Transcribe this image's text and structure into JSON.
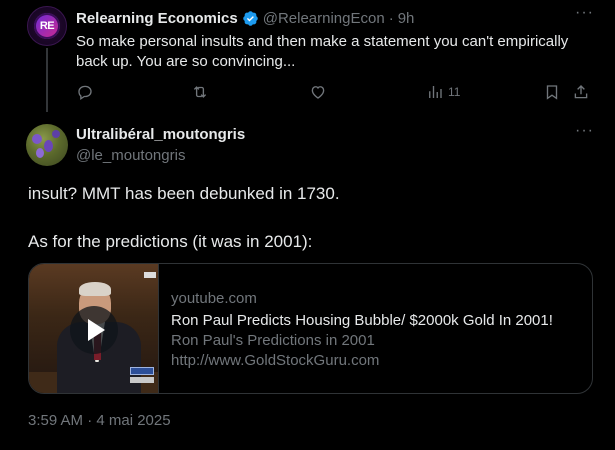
{
  "parent_tweet": {
    "avatar_text": "RE",
    "name": "Relearning Economics",
    "handle": "@RelearningEcon",
    "dot": "·",
    "time": "9h",
    "text": "So make personal insults and then make a statement you can't empirically back up. You are so convincing...",
    "actions": {
      "views_count": "11"
    }
  },
  "main_tweet": {
    "name": "Ultralibéral_moutongris",
    "handle": "@le_moutongris",
    "text_line1": "insult? MMT has been debunked in 1730.",
    "text_line2": "As for the predictions (it was in 2001):",
    "card": {
      "domain": "youtube.com",
      "title": "Ron Paul Predicts Housing Bubble/ $2000k Gold In 2001!",
      "description": "Ron Paul's Predictions in 2001",
      "url": "http://www.GoldStockGuru.com"
    },
    "timestamp": "3:59 AM · 4 mai 2025"
  },
  "colors": {
    "background": "#000000",
    "text_primary": "#e7e9ea",
    "text_secondary": "#71767b",
    "verified_blue": "#1d9bf0",
    "border": "#2f3336"
  }
}
